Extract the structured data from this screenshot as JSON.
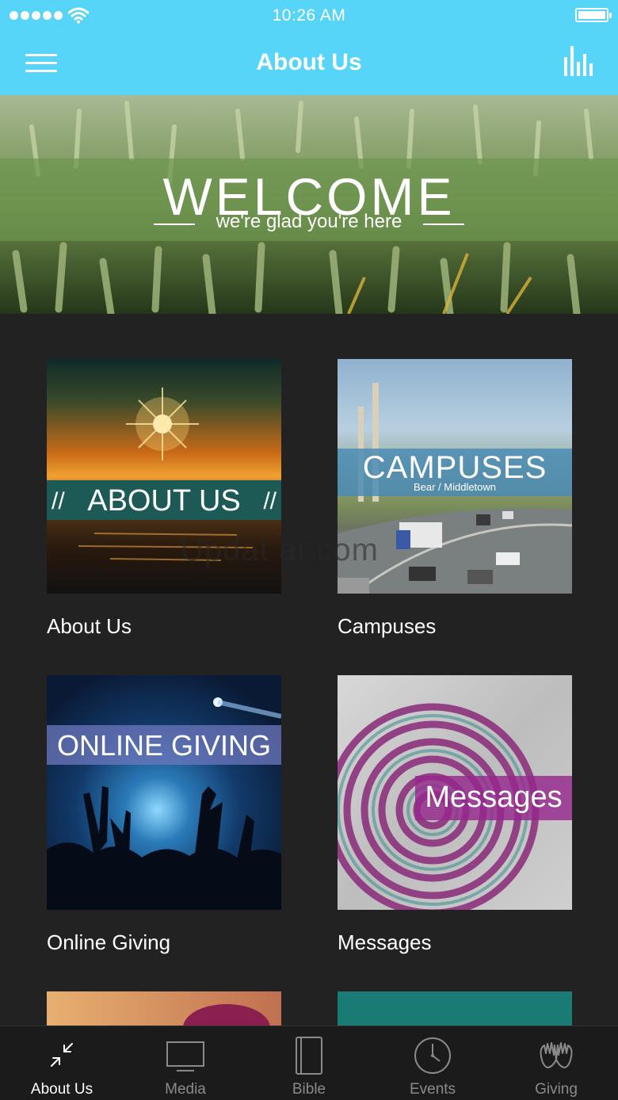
{
  "status_bar": {
    "time": "10:26 AM",
    "signal_icon": "signal-dots-icon",
    "wifi_icon": "wifi-icon",
    "battery_icon": "battery-full-icon"
  },
  "nav": {
    "title": "About Us",
    "menu_icon": "hamburger-menu-icon",
    "stats_icon": "bar-chart-icon"
  },
  "hero": {
    "title": "WELCOME",
    "subtitle": "we're glad you're here"
  },
  "tiles": [
    {
      "caption": "About Us",
      "banner": "ABOUT US",
      "banner_deco": "//"
    },
    {
      "caption": "Campuses",
      "banner": "CAMPUSES",
      "banner_sub": "Bear / Middletown"
    },
    {
      "caption": "Online Giving",
      "banner": "ONLINE GIVING"
    },
    {
      "caption": "Messages",
      "banner": "Messages"
    }
  ],
  "watermark": "Updat ar.com",
  "tabs": [
    {
      "label": "About Us",
      "icon": "collapse-arrows-icon",
      "active": true
    },
    {
      "label": "Media",
      "icon": "monitor-icon",
      "active": false
    },
    {
      "label": "Bible",
      "icon": "book-icon",
      "active": false
    },
    {
      "label": "Events",
      "icon": "clock-icon",
      "active": false
    },
    {
      "label": "Giving",
      "icon": "praying-hands-icon",
      "active": false
    }
  ],
  "colors": {
    "accent": "#56d5f9",
    "background": "#222222",
    "tabbar": "#1b1b1b",
    "tab_inactive": "#8a8a8a"
  }
}
